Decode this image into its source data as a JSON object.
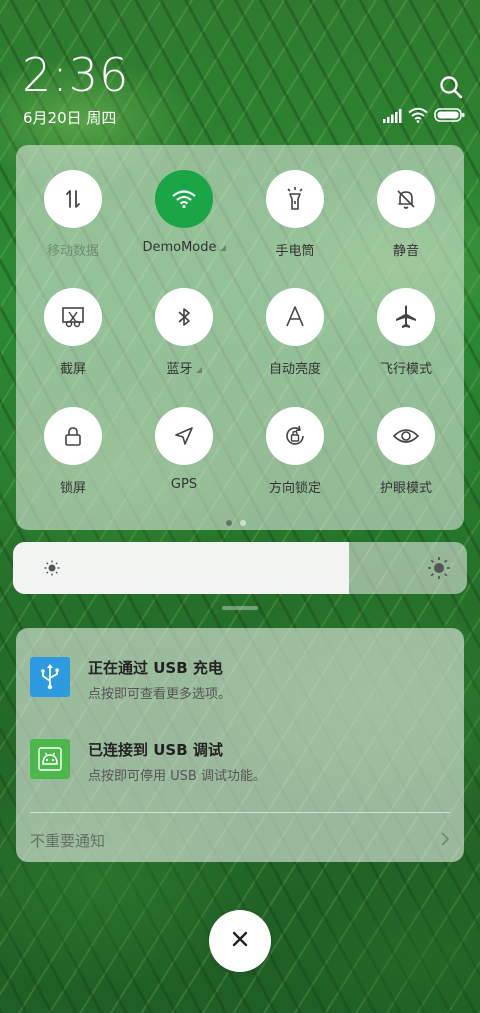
{
  "status": {
    "time": "2:36",
    "date": "6月20日 周四",
    "icons": [
      "signal-icon",
      "wifi-icon",
      "battery-icon"
    ]
  },
  "quick_settings": {
    "tiles": [
      {
        "label": "移动数据",
        "icon": "data-transfer-icon",
        "active": false,
        "dim": true
      },
      {
        "label": "DemoMode",
        "icon": "wifi-icon",
        "active": true
      },
      {
        "label": "手电筒",
        "icon": "flashlight-icon",
        "active": false
      },
      {
        "label": "静音",
        "icon": "bell-off-icon",
        "active": false
      },
      {
        "label": "截屏",
        "icon": "screenshot-icon",
        "active": false
      },
      {
        "label": "蓝牙",
        "icon": "bluetooth-icon",
        "active": false
      },
      {
        "label": "自动亮度",
        "icon": "auto-brightness-icon",
        "active": false
      },
      {
        "label": "飞行模式",
        "icon": "airplane-icon",
        "active": false
      },
      {
        "label": "锁屏",
        "icon": "lock-icon",
        "active": false
      },
      {
        "label": "GPS",
        "icon": "location-arrow-icon",
        "active": false
      },
      {
        "label": "方向锁定",
        "icon": "rotation-lock-icon",
        "active": false
      },
      {
        "label": "护眼模式",
        "icon": "eye-icon",
        "active": false
      }
    ],
    "page_count": 2,
    "current_page": 1
  },
  "brightness": {
    "level": 0.74
  },
  "notifications": [
    {
      "title": "正在通过 USB 充电",
      "text": "点按即可查看更多选项。",
      "icon": "usb-icon",
      "color": "#2e9be0"
    },
    {
      "title": "已连接到 USB 调试",
      "text": "点按即可停用 USB 调试功能。",
      "icon": "android-icon",
      "color": "#4cb84c"
    }
  ],
  "unimportant_label": "不重要通知",
  "colors": {
    "accent": "#1aa547"
  }
}
